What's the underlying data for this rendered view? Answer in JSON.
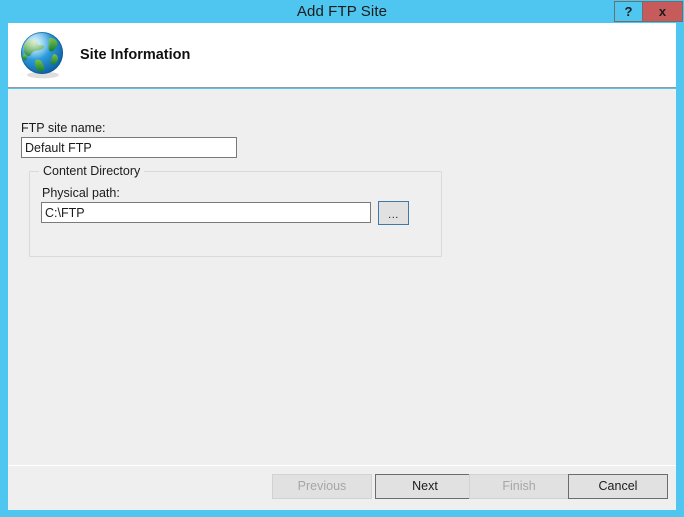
{
  "window": {
    "title": "Add FTP Site",
    "accent_color": "#4ec6ef",
    "close_color": "#c75b5b",
    "body_color": "#efeff0"
  },
  "titlebar": {
    "help_label": "?",
    "close_label": "x",
    "help_icon": "question-mark-icon",
    "close_icon": "close-x-icon"
  },
  "header": {
    "icon": "globe-icon",
    "title": "Site Information"
  },
  "form": {
    "ftp_site_name": {
      "label": "FTP site name:",
      "value": "Default FTP",
      "placeholder": ""
    },
    "content_directory": {
      "legend": "Content Directory",
      "physical_path": {
        "label": "Physical path:",
        "value": "C:\\FTP",
        "placeholder": ""
      },
      "browse_label": "...",
      "browse_icon": "ellipsis-icon",
      "browse_border_color": "#3f79a8"
    }
  },
  "footer": {
    "buttons": [
      {
        "label": "Previous",
        "enabled": false
      },
      {
        "label": "Next",
        "enabled": true
      },
      {
        "label": "Finish",
        "enabled": false
      },
      {
        "label": "Cancel",
        "enabled": true
      }
    ]
  }
}
